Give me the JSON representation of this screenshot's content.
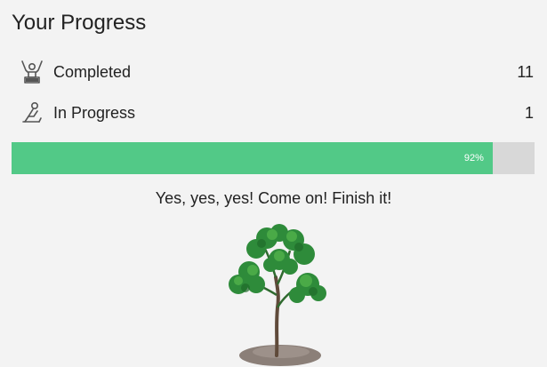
{
  "title": "Your Progress",
  "stats": {
    "completed": {
      "label": "Completed",
      "count": "11",
      "icon": "raised-arms-icon"
    },
    "in_progress": {
      "label": "In Progress",
      "count": "1",
      "icon": "person-working-icon"
    }
  },
  "progress": {
    "value": 0.92,
    "label": "92%",
    "fill_color": "#52c987",
    "track_color": "#d8d8d8"
  },
  "message": "Yes, yes, yes! Come on! Finish it!",
  "illustration": "tree-icon"
}
